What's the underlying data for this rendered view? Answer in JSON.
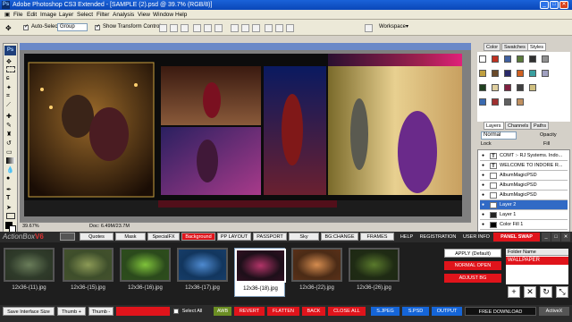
{
  "window": {
    "app_icon": "Ps",
    "title": "Adobe Photoshop CS3 Extended - [SAMPLE (2).psd @ 39.7% (RGB/8)]"
  },
  "menu": [
    "File",
    "Edit",
    "Image",
    "Layer",
    "Select",
    "Filter",
    "Analysis",
    "View",
    "Window",
    "Help"
  ],
  "options_bar": {
    "auto_select_label": "Auto-Select:",
    "auto_select_checked": true,
    "group_value": "Group",
    "show_transform_label": "Show Transform Controls",
    "show_transform_checked": true,
    "workspace_label": "Workspace"
  },
  "tools_panel": {
    "logo": "Ps"
  },
  "document": {
    "zoom": "39.67%",
    "doc_info": "Doc: 6.49M/23.7M"
  },
  "panels": {
    "top_tabs": [
      "Color",
      "Swatches",
      "Styles"
    ],
    "active_top_tab": "Styles",
    "layer_tabs": [
      "Layers",
      "Channels",
      "Paths"
    ],
    "blend_mode": "Normal",
    "opacity_label": "Opacity",
    "lock_label": "Lock",
    "fill_label": "Fill",
    "layers": [
      "COMT :- RJ Systems. Indo...",
      "WELCOME TO INDORE R...",
      "AlbumMagicPSD",
      "AlbumMagicPSD",
      "AlbumMagicPSD",
      "Layer 2",
      "Layer 1",
      "Color Fill 1"
    ],
    "selected_layer_index": 5
  },
  "actionbox": {
    "logo_text": "ActionBox",
    "logo_version": "V6",
    "tabs": [
      "Quotes",
      "Mask",
      "SpecialFX",
      "Background",
      "PP LAYOUT",
      "PASSPORT",
      "Sky",
      "BG:CHANGE",
      "FRAMES"
    ],
    "active_tab": "Background",
    "right_tabs": [
      "HELP",
      "REGISTRATION",
      "USER INFO",
      "PANEL SWAP"
    ],
    "thumbnails": [
      {
        "label": "12x36-(11).jpg",
        "colors": [
          "#2f3b2a",
          "#6a7d5a",
          "#2a3324"
        ]
      },
      {
        "label": "12x36-(15).jpg",
        "colors": [
          "#3e4e2b",
          "#8c9a56",
          "#43512c"
        ]
      },
      {
        "label": "12x36-(16).jpg",
        "colors": [
          "#2b4a1c",
          "#7fc23a",
          "#2d4d1c"
        ]
      },
      {
        "label": "12x36-(17).jpg",
        "colors": [
          "#12365e",
          "#4e8ad0",
          "#163d69"
        ]
      },
      {
        "label": "12x36-(18).jpg",
        "colors": [
          "#1d0f19",
          "#b23468",
          "#311022"
        ]
      },
      {
        "label": "12x36-(22).jpg",
        "colors": [
          "#4b2b16",
          "#d58c4f",
          "#5a3018"
        ]
      },
      {
        "label": "12x36-(26).jpg",
        "colors": [
          "#1f2b14",
          "#5a7a2c",
          "#1e2813"
        ]
      }
    ],
    "selected_thumb_index": 4,
    "apply_label": "APPLY (Default)",
    "normal_open_label": "NORMAL OPEN",
    "adjust_bg_label": "ADJUST BG",
    "folder_header": "Folder Name",
    "folder_value": "WALLPAPER",
    "bottom_buttons": {
      "save_size": "Save Interface Size",
      "thumb_plus": "Thumb +",
      "thumb_minus": "Thumb -",
      "select_all": "Select All",
      "awb": "AWB",
      "revert": "REVERT",
      "flatten": "FLATTEN",
      "back": "BACK",
      "close_all": "CLOSE ALL",
      "s_jpeg": "S.JPEG",
      "s_psd": "S.PSD",
      "output": "OUTPUT",
      "free_download": "FREE DOWNLOAD",
      "activex": "ActiveX"
    }
  }
}
